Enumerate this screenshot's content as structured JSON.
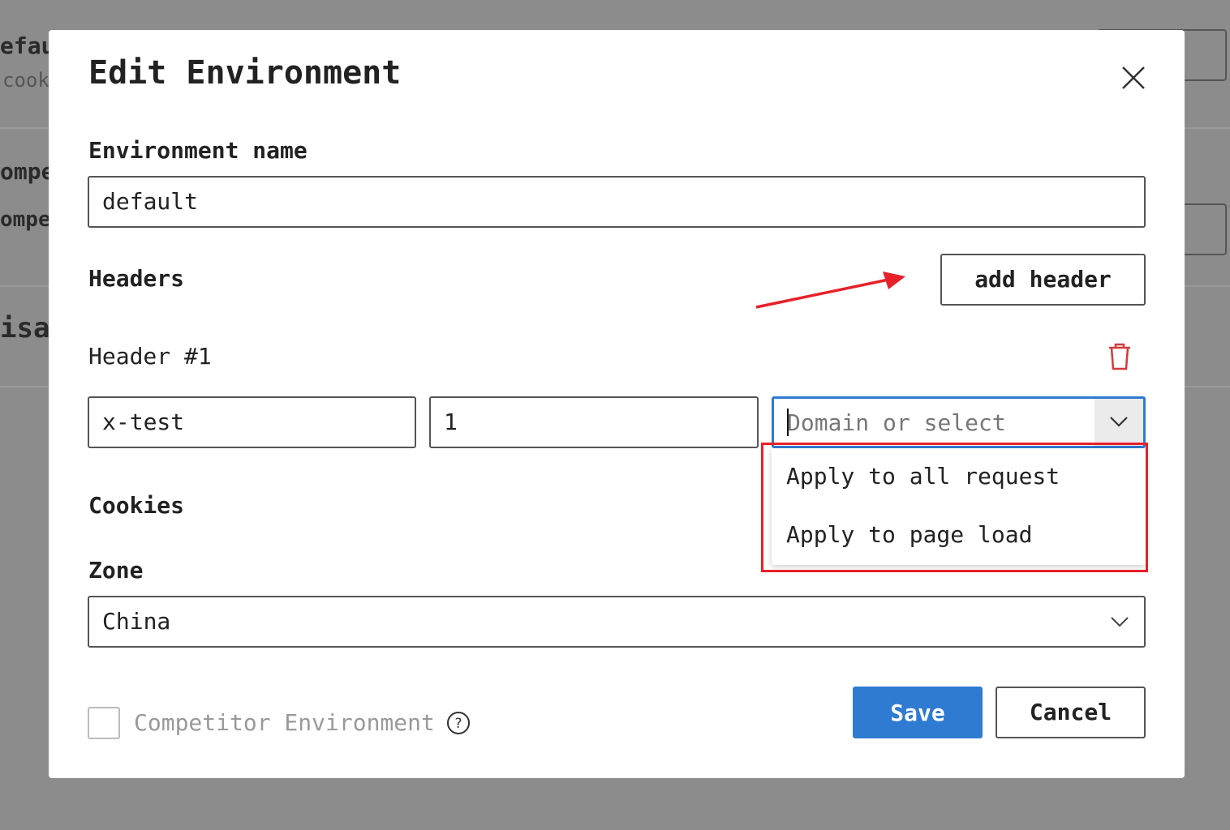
{
  "background": {
    "fragments": [
      "efaul",
      "cook",
      "ompe",
      "ompet",
      "isab"
    ]
  },
  "modal": {
    "title": "Edit Environment",
    "env_name_label": "Environment name",
    "env_name_value": "default",
    "headers_label": "Headers",
    "add_header_label": "add header",
    "header_item": {
      "title": "Header #1",
      "name": "x-test",
      "value": "1",
      "domain_placeholder": "Domain or select"
    },
    "domain_options": [
      "Apply to all request",
      "Apply to page load"
    ],
    "cookies_label": "Cookies",
    "zone_label": "Zone",
    "zone_value": "China",
    "competitor_label": "Competitor Environment",
    "competitor_checked": false,
    "save_label": "Save",
    "cancel_label": "Cancel"
  },
  "colors": {
    "primary": "#2f7bd1",
    "danger": "#d23b3b",
    "annotation": "#e8202a"
  }
}
